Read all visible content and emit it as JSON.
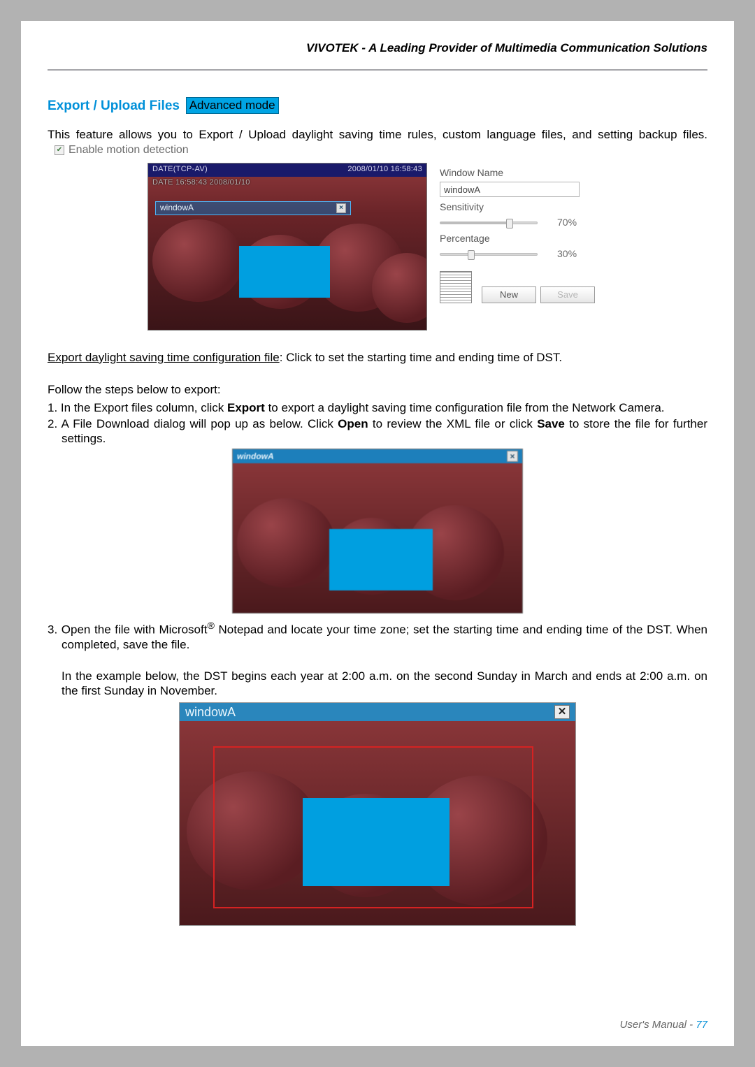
{
  "header": {
    "brand": "VIVOTEK - A Leading Provider of Multimedia Communication Solutions"
  },
  "section": {
    "title": "Export / Upload Files",
    "badge": "Advanced mode"
  },
  "intro": {
    "line1": "This feature allows you to Export / Upload daylight saving time rules, custom language files, and setting backup files.",
    "checkbox_label": "Enable motion detection"
  },
  "shot1": {
    "top_left": "DATE(TCP-AV)",
    "top_right": "2008/01/10 16:58:43",
    "overlay": "DATE 16:58:43 2008/01/10",
    "win_label": "windowA"
  },
  "controls": {
    "window_name_label": "Window Name",
    "window_name_value": "windowA",
    "sensitivity_label": "Sensitivity",
    "sensitivity_value": "70%",
    "percentage_label": "Percentage",
    "percentage_value": "30%",
    "btn_new": "New",
    "btn_save": "Save"
  },
  "steps": {
    "export_heading": "Export daylight saving time configuration file",
    "export_rest": ": Click to set the starting time and ending time of DST.",
    "follow": "Follow the steps below to export:",
    "s1a": "1. In the Export files column, click ",
    "s1b": "Export",
    "s1c": " to export a daylight saving time configuration file from the Network Camera.",
    "s2a": "2. A File Download dialog will pop up as below. Click ",
    "s2b": "Open",
    "s2c": " to review the XML file or click ",
    "s2d": "Save",
    "s2e": " to store the file for further settings.",
    "s3a": "3. Open the file with Microsoft",
    "s3b": " Notepad and locate your time zone; set the starting time and ending time of the DST. When completed, save the file.",
    "example": "In the example below, the DST begins each year at 2:00 a.m. on the second Sunday in March and ends at 2:00 a.m. on the first Sunday in November."
  },
  "shot2": {
    "win_label": "windowA"
  },
  "shot3": {
    "win_label": "windowA"
  },
  "footer": {
    "label": "User's Manual - ",
    "page": "77"
  }
}
